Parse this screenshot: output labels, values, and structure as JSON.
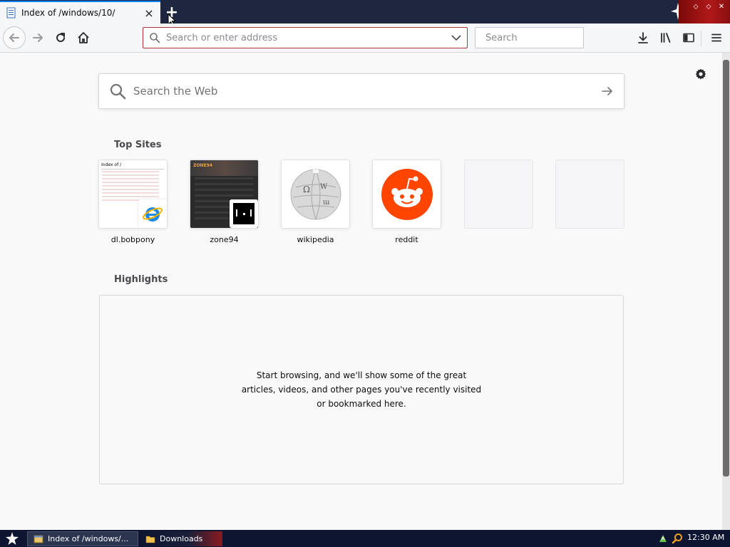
{
  "tab": {
    "title": "Index of /windows/10/",
    "close_glyph": "×",
    "new_tab_glyph": "+"
  },
  "toolbar": {
    "url_placeholder": "Search or enter address",
    "search_placeholder": "Search"
  },
  "newtab": {
    "websearch_placeholder": "Search the Web",
    "top_sites_title": "Top Sites",
    "top_sites": [
      {
        "label": "dl.bobpony"
      },
      {
        "label": "zone94"
      },
      {
        "label": "wikipedia"
      },
      {
        "label": "reddit"
      },
      {
        "label": ""
      },
      {
        "label": ""
      }
    ],
    "highlights_title": "Highlights",
    "highlights_empty": "Start browsing, and we'll show some of the great articles, videos, and other pages you've recently visited or bookmarked here."
  },
  "taskbar": {
    "items": [
      {
        "label": "Index of /windows/..."
      },
      {
        "label": "Downloads"
      }
    ],
    "clock": "12:30 AM"
  },
  "colors": {
    "accent": "#0a84ff",
    "urlbar_border": "#b0333a",
    "reddit": "#ff4500",
    "taskbar": "#0d1530"
  },
  "thumbs": {
    "bobpony_heading": "Index of /",
    "zone94_heading": "ZONE94"
  }
}
